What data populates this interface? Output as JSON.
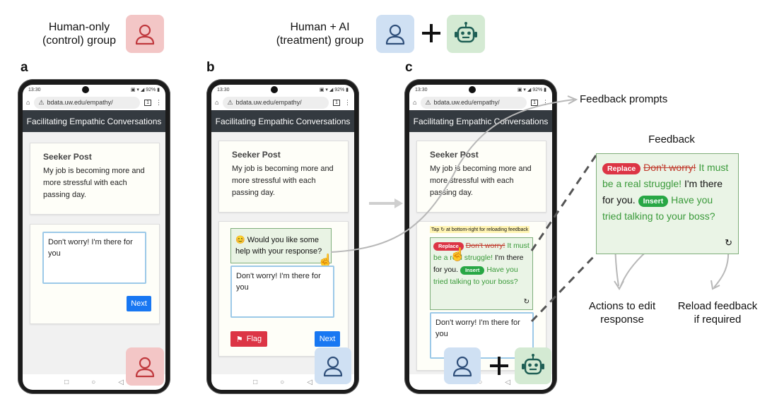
{
  "groups": {
    "control_label": "Human-only\n(control) group",
    "treatment_label": "Human + AI\n(treatment) group"
  },
  "panels": [
    "a",
    "b",
    "c"
  ],
  "phone": {
    "time": "13:30",
    "status_icons": "▣ ▾ ◢ 92% ▮",
    "url": "bdata.uw.edu/empathy/",
    "tab_count": "1",
    "app_title": "Facilitating Empathic Conversations"
  },
  "seeker": {
    "title": "Seeker Post",
    "text": "My job is becoming more and more stressful with each passing day."
  },
  "response_text": "Don't worry! I'm there for you",
  "prompt_text": "Would you like some help with your response?",
  "prompt_emoji": "😊",
  "tap_hint": "Tap ↻ at bottom-right for reloading feedback",
  "buttons": {
    "next": "Next",
    "flag": "Flag"
  },
  "feedback": {
    "replace": "Replace",
    "struck": "Don't worry!",
    "green1": "It must be a real struggle!",
    "plain": "I'm there for you.",
    "insert": "Insert",
    "green2": "Have you tried talking to your boss?"
  },
  "annotations": {
    "feedback_prompts": "Feedback prompts",
    "feedback": "Feedback",
    "actions": "Actions to edit\nresponse",
    "reload": "Reload feedback\nif required"
  },
  "colors": {
    "human_tile": "#f3c6c6",
    "human_tile_blue": "#cfe0f3",
    "ai_tile": "#d4ead3",
    "app_bar": "#343a40",
    "next_button": "#1877f2",
    "flag_button": "#dc3545",
    "feedback_green": "#3a9a3a"
  },
  "icons": [
    "person-icon",
    "robot-icon",
    "plus-icon",
    "home-icon",
    "warning-icon",
    "reload-icon",
    "flag-icon",
    "cursor-hand-icon"
  ]
}
